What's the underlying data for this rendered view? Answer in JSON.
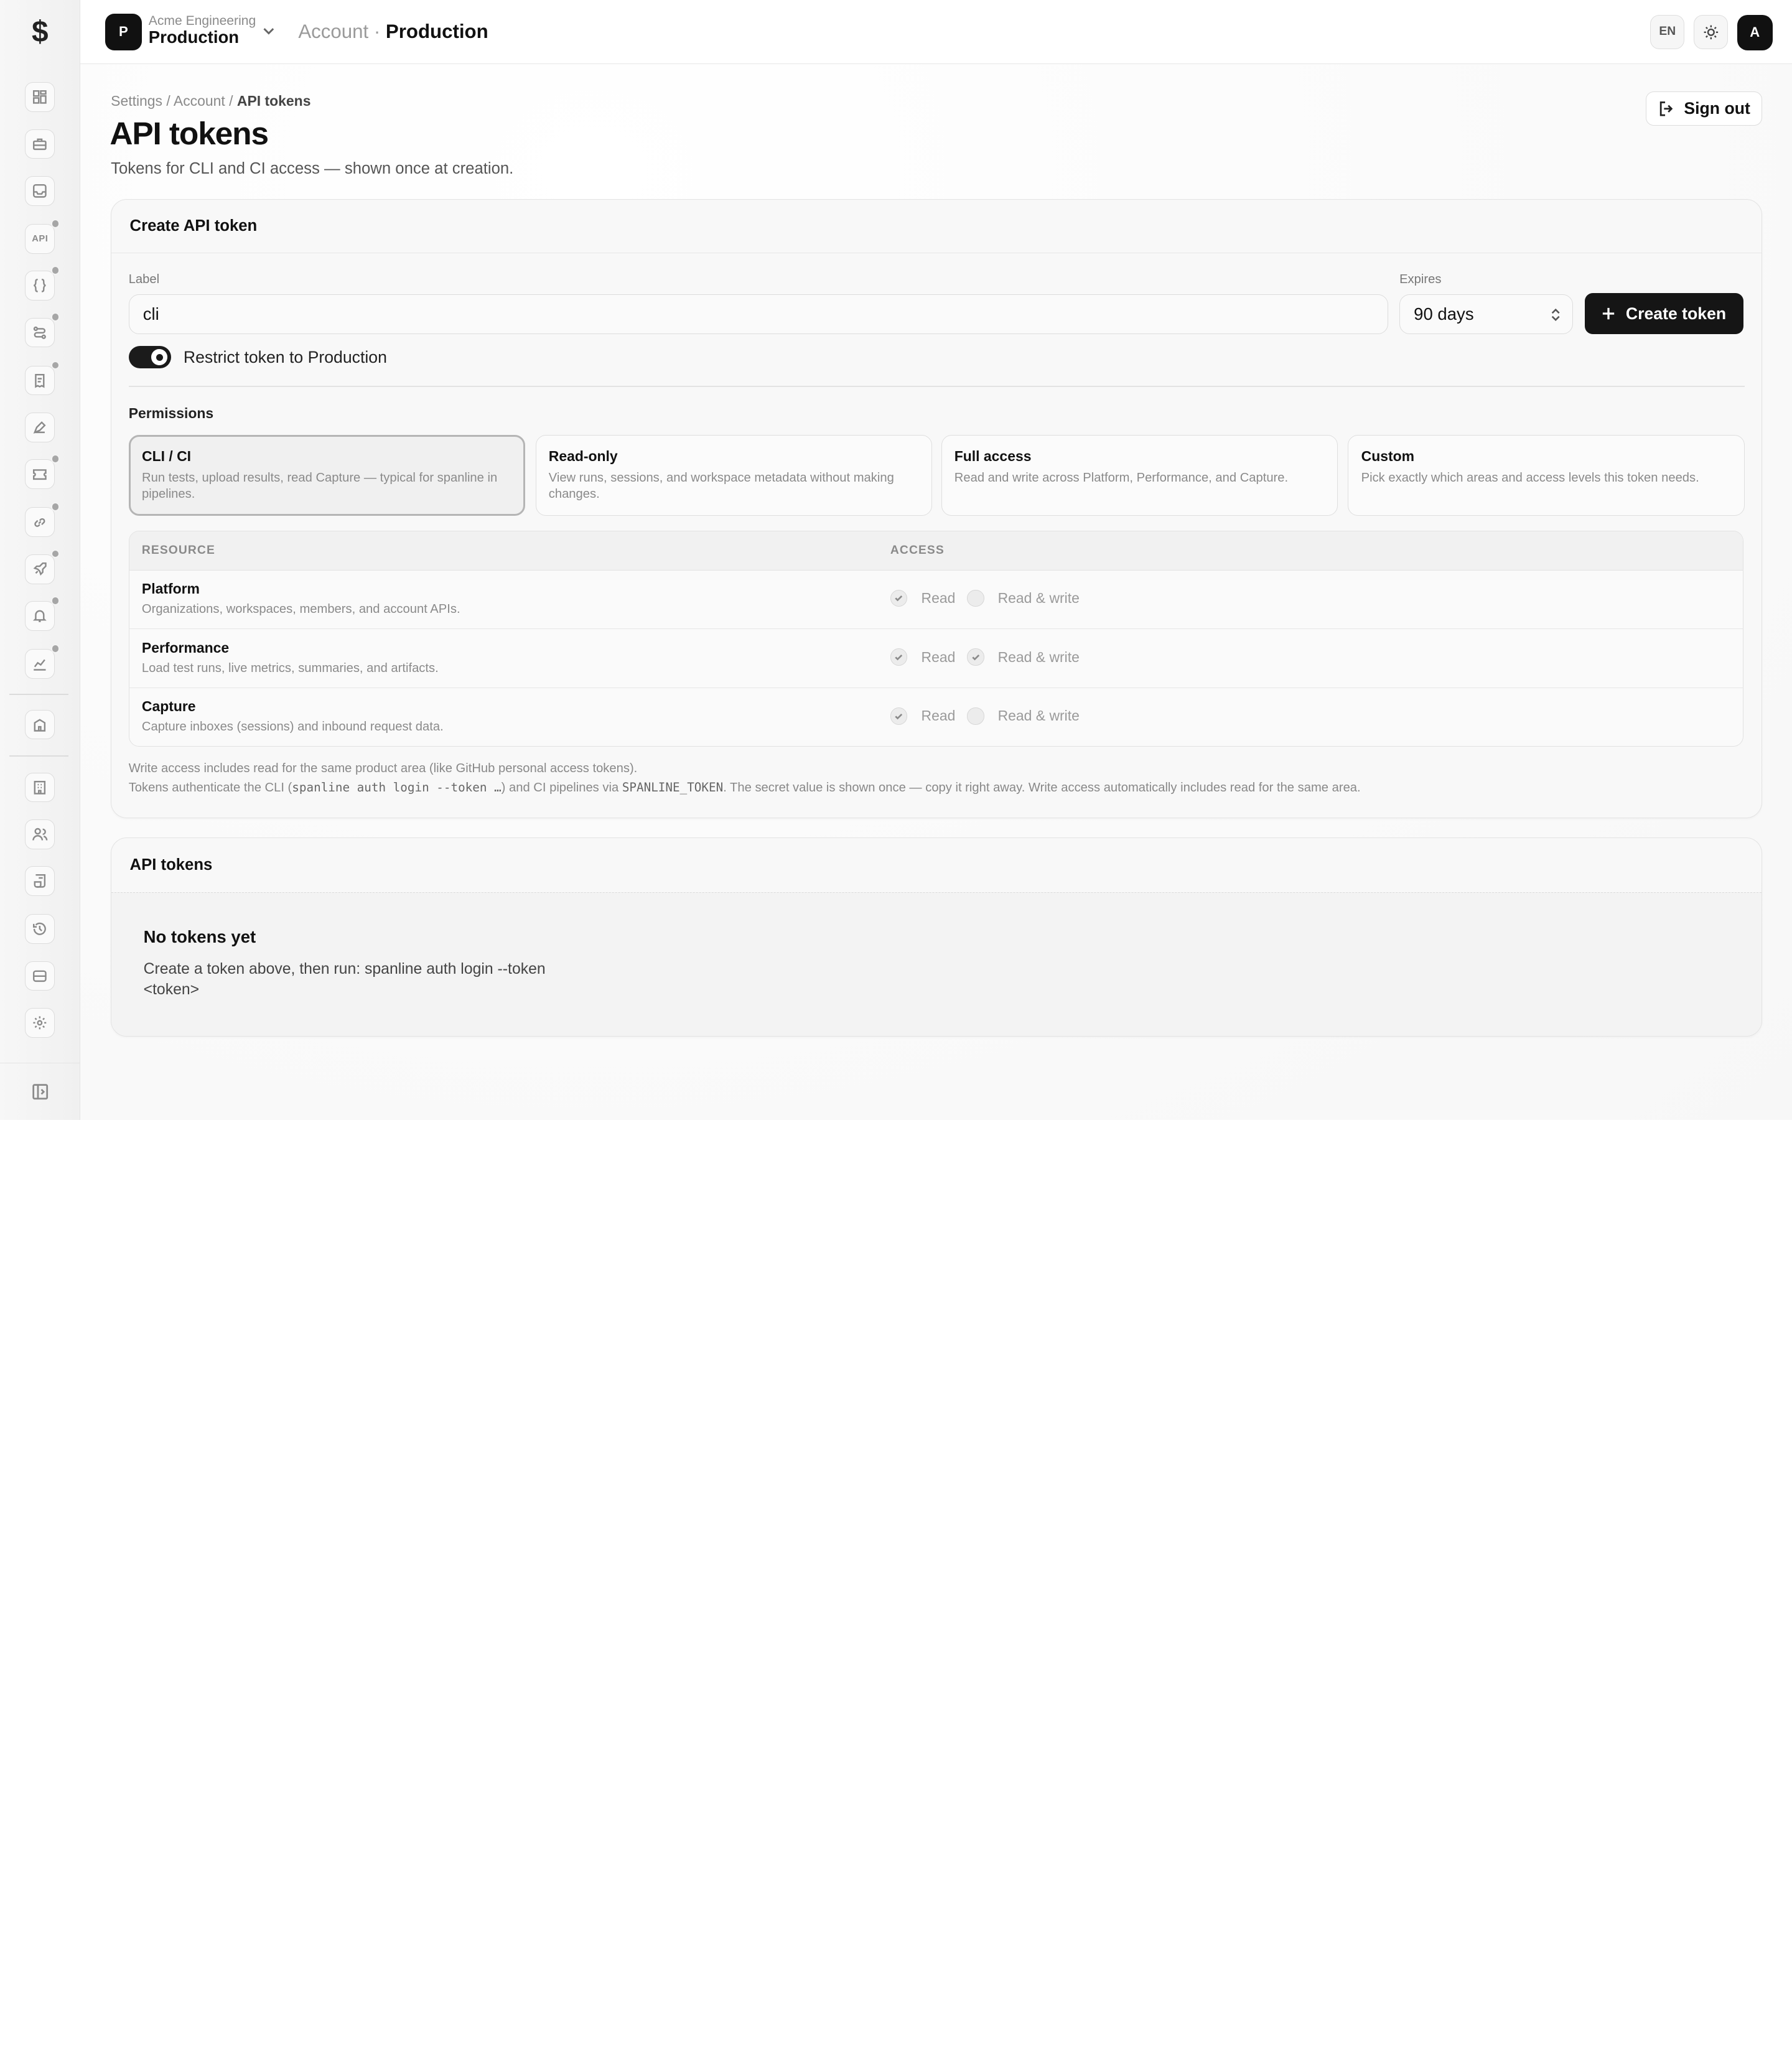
{
  "brand": {
    "logo_glyph": "$"
  },
  "workspace": {
    "avatar_letter": "P",
    "org": "Acme Engineering",
    "name": "Production"
  },
  "topbar": {
    "crumb_parent": "Account",
    "crumb_sep": " · ",
    "crumb_current": "Production",
    "lang": "EN",
    "user_avatar": "A"
  },
  "sidebar": {
    "items": [
      {
        "name": "dashboard-icon",
        "dot": false
      },
      {
        "name": "briefcase-icon",
        "dot": false
      },
      {
        "name": "inbox-icon",
        "dot": false
      },
      {
        "name": "api-icon",
        "label": "API",
        "dot": true
      },
      {
        "name": "braces-icon",
        "dot": true
      },
      {
        "name": "route-icon",
        "dot": true
      },
      {
        "name": "report-icon",
        "dot": true
      },
      {
        "name": "pen-tool-icon",
        "dot": false
      },
      {
        "name": "ticket-icon",
        "dot": true
      },
      {
        "name": "link-icon",
        "dot": true
      },
      {
        "name": "rocket-icon",
        "dot": true
      },
      {
        "name": "bell-icon",
        "dot": true
      },
      {
        "name": "chart-icon",
        "dot": true
      },
      {
        "name": "building-icon",
        "dot": false
      },
      {
        "name": "organization-icon",
        "dot": false
      },
      {
        "name": "users-icon",
        "dot": false
      },
      {
        "name": "receipt-icon",
        "dot": false
      },
      {
        "name": "history-icon",
        "dot": false
      },
      {
        "name": "storage-icon",
        "dot": false
      },
      {
        "name": "gear-icon",
        "dot": false
      }
    ]
  },
  "page": {
    "breadcrumb": {
      "settings": "Settings",
      "account": "Account",
      "current": "API tokens",
      "sep": " / "
    },
    "title": "API tokens",
    "subtitle": "Tokens for CLI and CI access — shown once at creation.",
    "sign_out": "Sign out"
  },
  "create": {
    "heading": "Create API token",
    "label_caption": "Label",
    "label_value": "cli",
    "expires_caption": "Expires",
    "expires_value": "90 days",
    "create_button": "Create token",
    "restrict_toggle": {
      "label": "Restrict token to Production",
      "on": true
    },
    "permissions_title": "Permissions",
    "presets": [
      {
        "title": "CLI / CI",
        "desc": "Run tests, upload results, read Capture — typical for spanline in pipelines.",
        "selected": true
      },
      {
        "title": "Read-only",
        "desc": "View runs, sessions, and workspace metadata without making changes.",
        "selected": false
      },
      {
        "title": "Full access",
        "desc": "Read and write across Platform, Performance, and Capture.",
        "selected": false
      },
      {
        "title": "Custom",
        "desc": "Pick exactly which areas and access levels this token needs.",
        "selected": false
      }
    ],
    "table": {
      "col_resource": "RESOURCE",
      "col_access": "ACCESS",
      "read_label": "Read",
      "write_label": "Read & write",
      "rows": [
        {
          "name": "Platform",
          "desc": "Organizations, workspaces, members, and account APIs.",
          "read": true,
          "write": false
        },
        {
          "name": "Performance",
          "desc": "Load test runs, live metrics, summaries, and artifacts.",
          "read": true,
          "write": true
        },
        {
          "name": "Capture",
          "desc": "Capture inboxes (sessions) and inbound request data.",
          "read": true,
          "write": false
        }
      ]
    },
    "note1": "Write access includes read for the same product area (like GitHub personal access tokens).",
    "note2_a": "Tokens authenticate the CLI (",
    "note2_code1": "spanline auth login --token …",
    "note2_b": ") and CI pipelines via ",
    "note2_code2": "SPANLINE_TOKEN",
    "note2_c": ". The secret value is shown once — copy it right away. Write access automatically includes read for the same area."
  },
  "tokens": {
    "heading": "API tokens",
    "empty_title": "No tokens yet",
    "empty_desc": "Create a token above, then run: spanline auth login --token <token>"
  }
}
